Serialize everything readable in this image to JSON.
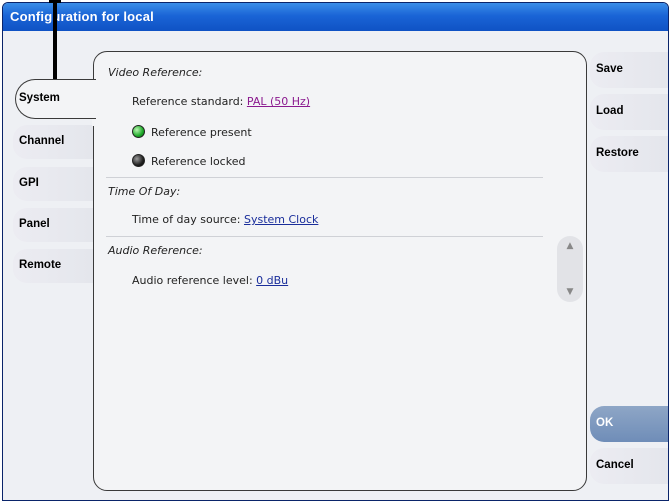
{
  "window": {
    "title": "Configuration for local"
  },
  "tabs": [
    {
      "label": "System",
      "active": true
    },
    {
      "label": "Channel"
    },
    {
      "label": "GPI"
    },
    {
      "label": "Panel"
    },
    {
      "label": "Remote"
    }
  ],
  "video_reference": {
    "title": "Video Reference:",
    "standard_label": "Reference standard:",
    "standard_value": "PAL (50 Hz)",
    "present_label": "Reference present",
    "present_color": "#1eaa2a",
    "locked_label": "Reference locked",
    "locked_color": "#222222"
  },
  "time_of_day": {
    "title": "Time Of Day:",
    "source_label": "Time of day source:",
    "source_value": "System Clock"
  },
  "audio_reference": {
    "title": "Audio Reference:",
    "level_label": "Audio reference level:",
    "level_value": "0 dBu"
  },
  "actions": {
    "save": "Save",
    "load": "Load",
    "restore": "Restore",
    "ok": "OK",
    "cancel": "Cancel"
  },
  "icons": {
    "scroll_up": "chevron-up-icon",
    "scroll_down": "chevron-down-icon"
  }
}
